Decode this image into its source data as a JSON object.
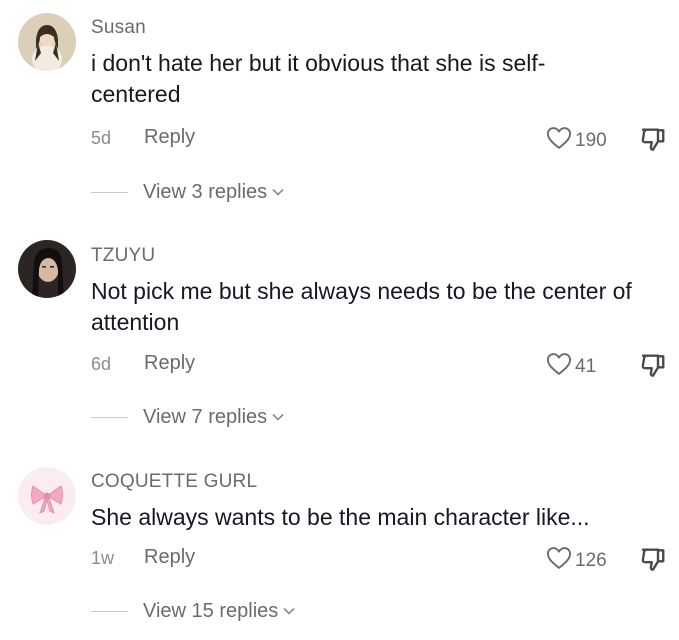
{
  "comments": [
    {
      "username": "Susan",
      "text": "i don't hate her but it obvious that she is self-centered",
      "time": "5d",
      "reply_label": "Reply",
      "likes": "190",
      "view_replies": "View 3 replies"
    },
    {
      "username": "TZUYU",
      "text": "Not pick me but she always needs to be the center of attention",
      "time": "6d",
      "reply_label": "Reply",
      "likes": "41",
      "view_replies": "View 7 replies"
    },
    {
      "username": "COQUETTE GURL",
      "text": "She always wants to be the main character like...",
      "time": "1w",
      "reply_label": "Reply",
      "likes": "126",
      "view_replies": "View 15 replies"
    }
  ],
  "icons": {
    "like": "heart-outline-icon",
    "dislike": "thumbs-down-icon",
    "expand": "chevron-down-icon"
  },
  "colors": {
    "text_primary": "#161823",
    "text_secondary": "#6b6b6b",
    "avatar_bow_pink": "#f3a9c0"
  }
}
